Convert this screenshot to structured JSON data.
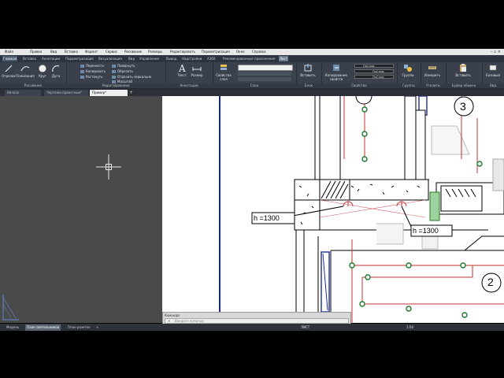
{
  "menu": [
    "Файл",
    "Правка",
    "Вид",
    "Вставка",
    "Формат",
    "Сервис",
    "Рисование",
    "Размеры",
    "Редактировать",
    "Параметризация",
    "Окно",
    "Справка"
  ],
  "ribbon_tabs": [
    "Главная",
    "Вставка",
    "Аннотации",
    "Параметризация",
    "Визуализация",
    "Вид",
    "Управление",
    "Вывод",
    "Надстройки",
    "A360",
    "Рекомендованные приложения",
    "Лист"
  ],
  "panels": {
    "draw": {
      "title": "Рисование",
      "buttons": [
        "Отрезок",
        "Полилиния",
        "Круг",
        "Дуга"
      ]
    },
    "modify": {
      "title": "Редактирование",
      "buttons": [
        "Перенести",
        "Повернуть",
        "Обрезать",
        "Копировать",
        "Отразить зеркально",
        "Растянуть",
        "Масштаб"
      ]
    },
    "annotation": {
      "title": "Аннотации",
      "buttons": [
        "Текст",
        "Размер"
      ]
    },
    "layers": {
      "title": "Слои",
      "buttons": [
        "Свойства слоя"
      ]
    },
    "block": {
      "title": "Блок",
      "buttons": [
        "Вставить"
      ]
    },
    "properties": {
      "title": "Свойства",
      "buttons": [
        "Копирование свойств"
      ],
      "values": [
        "ПоСлою",
        "ПоСлою",
        "ПоСлою"
      ]
    },
    "groups": {
      "title": "Группы",
      "buttons": [
        "Группа"
      ]
    },
    "utilities": {
      "title": "Утилиты",
      "buttons": [
        "Измерить"
      ]
    },
    "clipboard": {
      "title": "Буфер обмена",
      "buttons": [
        "Вставить"
      ]
    },
    "view": {
      "title": "Вид",
      "buttons": [
        "Базовый"
      ]
    }
  },
  "doc_tabs": [
    "Начало",
    "Чертежи проектные*",
    "Пример*"
  ],
  "drawing": {
    "labels": [
      "h =1300",
      "h =1300",
      "3",
      "2"
    ]
  },
  "cmdline": {
    "label": "Команда:",
    "placeholder": "Введите команду"
  },
  "layout_tabs": [
    "Модель",
    "План светильников",
    "План розеток"
  ],
  "status": {
    "mode": "ЛИСТ",
    "scale": "1:50"
  }
}
